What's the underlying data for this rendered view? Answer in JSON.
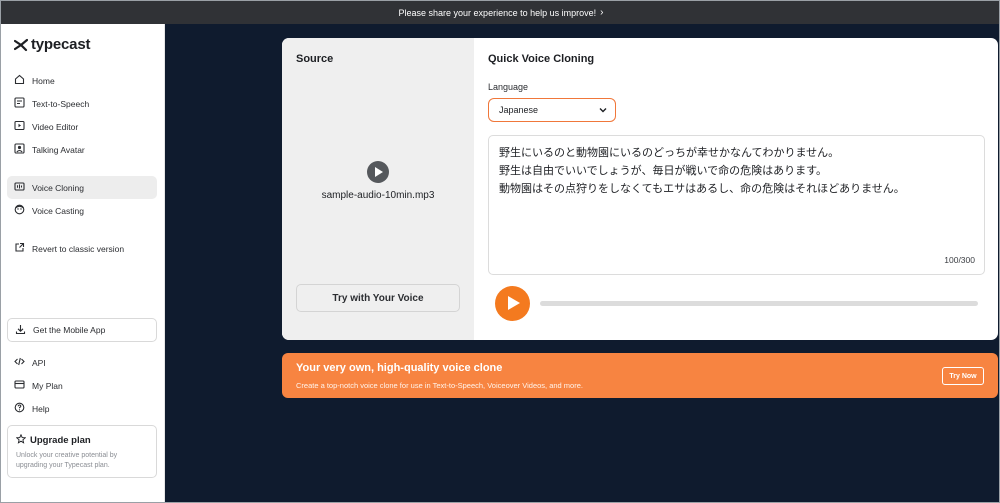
{
  "banner": {
    "text": "Please share your experience to help us improve!",
    "chevron": "›"
  },
  "logo": {
    "text": "typecast",
    "icon": "typecast-logo-icon"
  },
  "sidebar": {
    "items": [
      {
        "label": "Home",
        "icon": "home-icon"
      },
      {
        "label": "Text-to-Speech",
        "icon": "text-to-speech-icon"
      },
      {
        "label": "Video Editor",
        "icon": "video-editor-icon"
      },
      {
        "label": "Talking Avatar",
        "icon": "talking-avatar-icon"
      },
      {
        "label": "Voice Cloning",
        "icon": "voice-cloning-icon",
        "active": true
      },
      {
        "label": "Voice Casting",
        "icon": "voice-casting-icon"
      },
      {
        "label": "Revert to classic version",
        "icon": "external-link-icon"
      }
    ],
    "mobile_app": "Get the Mobile App",
    "bottom_items": [
      {
        "label": "API",
        "icon": "code-icon"
      },
      {
        "label": "My Plan",
        "icon": "credit-card-icon"
      },
      {
        "label": "Help",
        "icon": "help-icon"
      }
    ],
    "upgrade": {
      "title": "Upgrade plan",
      "line1": "Unlock your creative potential by",
      "line2": "upgrading your Typecast plan."
    }
  },
  "source": {
    "title": "Source",
    "file_name": "sample-audio-10min.mp3",
    "try_button": "Try with Your Voice"
  },
  "quick_clone": {
    "title": "Quick Voice Cloning",
    "language_label": "Language",
    "language_value": "Japanese",
    "text_lines": [
      "野生にいるのと動物園にいるのどっちが幸せかなんてわかりません。",
      "野生は自由でいいでしょうが、毎日が戦いで命の危険はあります。",
      "動物園はその点狩りをしなくてもエサはあるし、命の危険はそれほどありません。"
    ],
    "char_count": "100/300",
    "progress": 0
  },
  "promo": {
    "title": "Your very own, high-quality voice clone",
    "description": "Create a top-notch voice clone for use in Text-to-Speech, Voiceover Videos, and more.",
    "button": "Try Now"
  },
  "colors": {
    "accent": "#f47a1f",
    "promo_bg": "#f78441",
    "main_bg": "#0f1b2e",
    "banner_bg": "#303236"
  }
}
